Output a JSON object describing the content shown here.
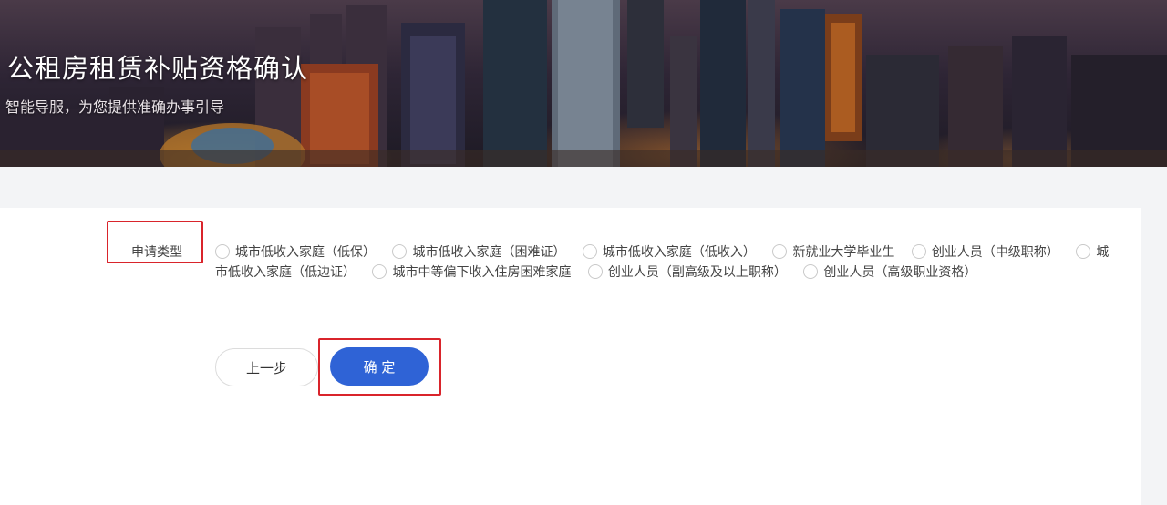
{
  "banner": {
    "title": "公租房租赁补贴资格确认",
    "subtitle": "智能导服，为您提供准确办事引导"
  },
  "form": {
    "label": "申请类型",
    "options": [
      "城市低收入家庭（低保）",
      "城市低收入家庭（困难证）",
      "城市低收入家庭（低收入）",
      "新就业大学毕业生",
      "创业人员（中级职称）",
      "城市低收入家庭（低边证）",
      "城市中等偏下收入住房困难家庭",
      "创业人员（副高级及以上职称）",
      "创业人员（高级职业资格）"
    ]
  },
  "buttons": {
    "prev_label": "上一步",
    "confirm_label": "确 定"
  },
  "colors": {
    "primary": "#2f63d6",
    "highlight": "#d9242b"
  }
}
